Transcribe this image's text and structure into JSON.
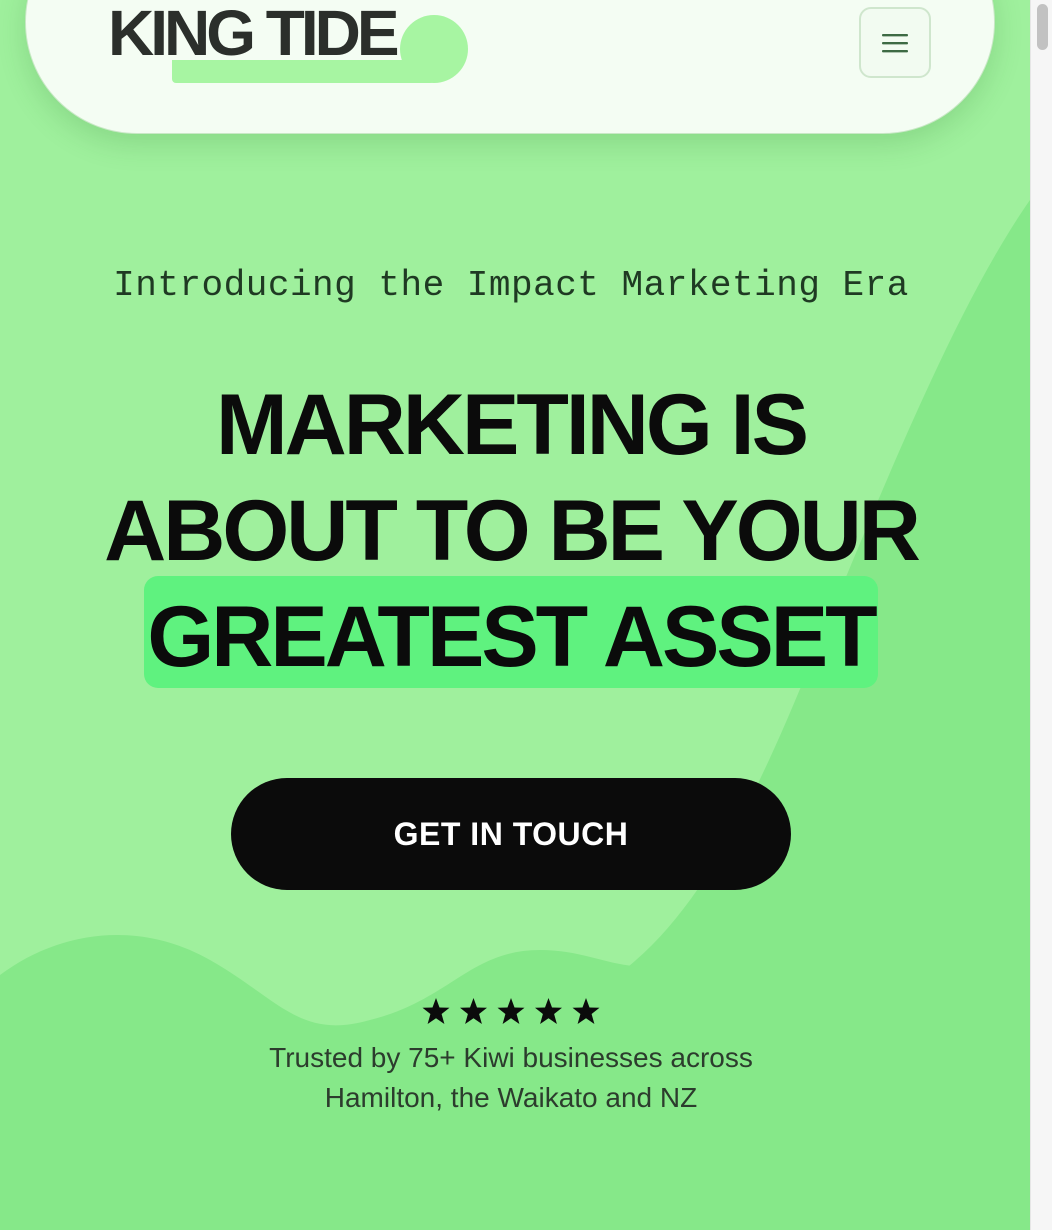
{
  "brand": {
    "logo_text": "KING TIDE",
    "logo_accent_color": "#a7f5a2"
  },
  "header": {
    "menu_icon": "hamburger-menu-icon"
  },
  "hero": {
    "eyebrow": "Introducing the Impact Marketing Era",
    "headline_line1": "MARKETING IS",
    "headline_line2": "ABOUT TO BE YOUR",
    "headline_highlight": "GREATEST ASSET",
    "highlight_color": "#5ff27f",
    "cta_label": "GET IN TOUCH"
  },
  "trust": {
    "rating_stars": 5,
    "star_icon": "star-icon",
    "line1": "Trusted by 75+ Kiwi businesses across",
    "line2": "Hamilton, the Waikato and NZ"
  },
  "colors": {
    "background": "#9ff09d",
    "background_wave": "#86e889",
    "header_bg": "#f4fdf3",
    "button_bg": "#0b0b0b",
    "text_dark": "#0b0b0b"
  }
}
